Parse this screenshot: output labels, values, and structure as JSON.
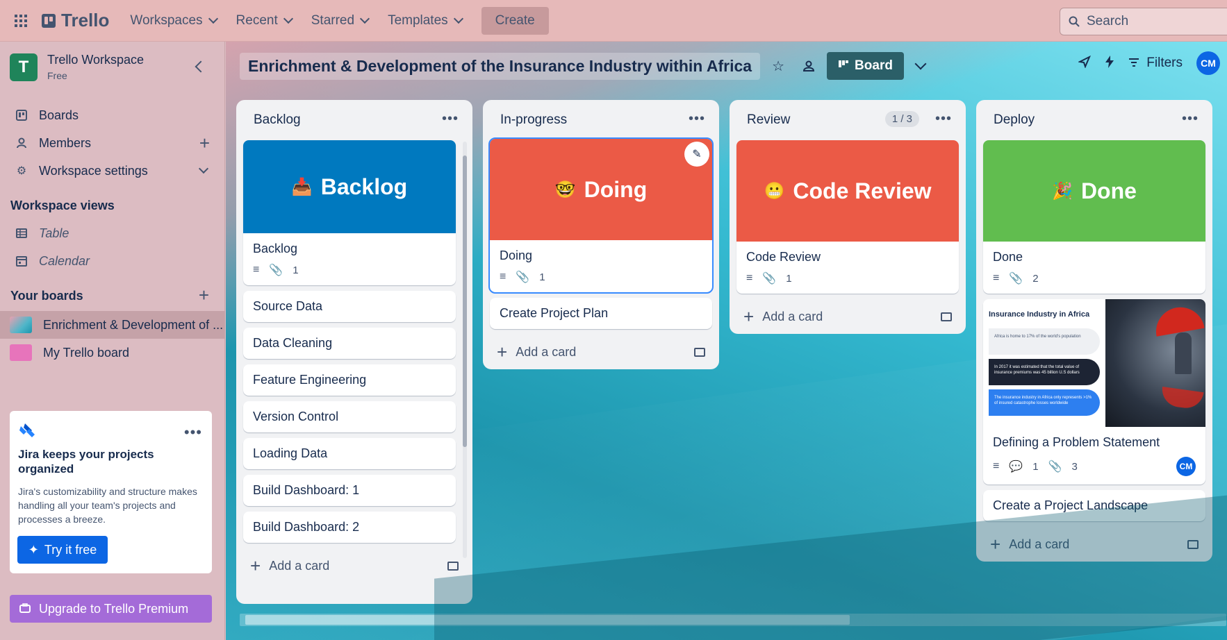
{
  "topbar": {
    "logo": "Trello",
    "nav": [
      "Workspaces",
      "Recent",
      "Starred",
      "Templates"
    ],
    "create": "Create",
    "search_placeholder": "Search"
  },
  "sidebar": {
    "workspace_initial": "T",
    "workspace_name": "Trello Workspace",
    "workspace_plan": "Free",
    "items": [
      {
        "label": "Boards",
        "icon": "board-icon"
      },
      {
        "label": "Members",
        "icon": "person-icon"
      },
      {
        "label": "Workspace settings",
        "icon": "gear-icon"
      }
    ],
    "views_title": "Workspace views",
    "views": [
      {
        "label": "Table",
        "icon": "table-icon"
      },
      {
        "label": "Calendar",
        "icon": "calendar-icon"
      }
    ],
    "boards_title": "Your boards",
    "boards": [
      {
        "label": "Enrichment & Development of ...",
        "color": "#4fb6c9"
      },
      {
        "label": "My Trello board",
        "color": "#e774bb"
      }
    ],
    "jira": {
      "title": "Jira keeps your projects organized",
      "text": "Jira's customizability and structure makes handling all your team's projects and processes a breeze.",
      "button": "Try it free"
    },
    "upgrade": "Upgrade to Trello Premium"
  },
  "board": {
    "title": "Enrichment & Development of the Insurance Industry within Africa",
    "view": "Board",
    "filters": "Filters",
    "avatar": "CM"
  },
  "lists": [
    {
      "title": "Backlog",
      "cover": {
        "emoji": "📥",
        "text": "Backlog",
        "color": "#0079bf"
      },
      "cover_card": {
        "title": "Backlog",
        "attachments": "1"
      },
      "cards": [
        "Source Data",
        "Data Cleaning",
        "Feature Engineering",
        "Version Control",
        "Loading Data",
        "Build Dashboard: 1",
        "Build Dashboard: 2"
      ],
      "add": "Add a card"
    },
    {
      "title": "In-progress",
      "cover": {
        "emoji": "🤓",
        "text": "Doing",
        "color": "#eb5a46"
      },
      "cover_card": {
        "title": "Doing",
        "attachments": "1"
      },
      "cards": [
        "Create Project Plan"
      ],
      "add": "Add a card"
    },
    {
      "title": "Review",
      "counter": "1 / 3",
      "cover": {
        "emoji": "😬",
        "text": "Code Review",
        "color": "#eb5a46"
      },
      "cover_card": {
        "title": "Code Review",
        "attachments": "1"
      },
      "cards": [],
      "add": "Add a card"
    },
    {
      "title": "Deploy",
      "cover": {
        "emoji": "🎉",
        "text": "Done",
        "color": "#61bd4f"
      },
      "cover_card": {
        "title": "Done",
        "attachments": "2"
      },
      "image_card": {
        "title": "Defining a Problem Statement",
        "comments": "1",
        "attachments": "3",
        "member": "CM",
        "image_heading": "Insurance Industry in Africa",
        "image_lines": [
          "Africa is home to 17% of the world's population",
          "In 2017 it was estimated that the total value of insurance premiums was 45 billion U.S dollars",
          "The insurance industry in Africa only represents >1% of insured catastrophe losses worldwide"
        ]
      },
      "cards": [
        "Create a Project Landscape"
      ],
      "add": "Add a card"
    }
  ]
}
